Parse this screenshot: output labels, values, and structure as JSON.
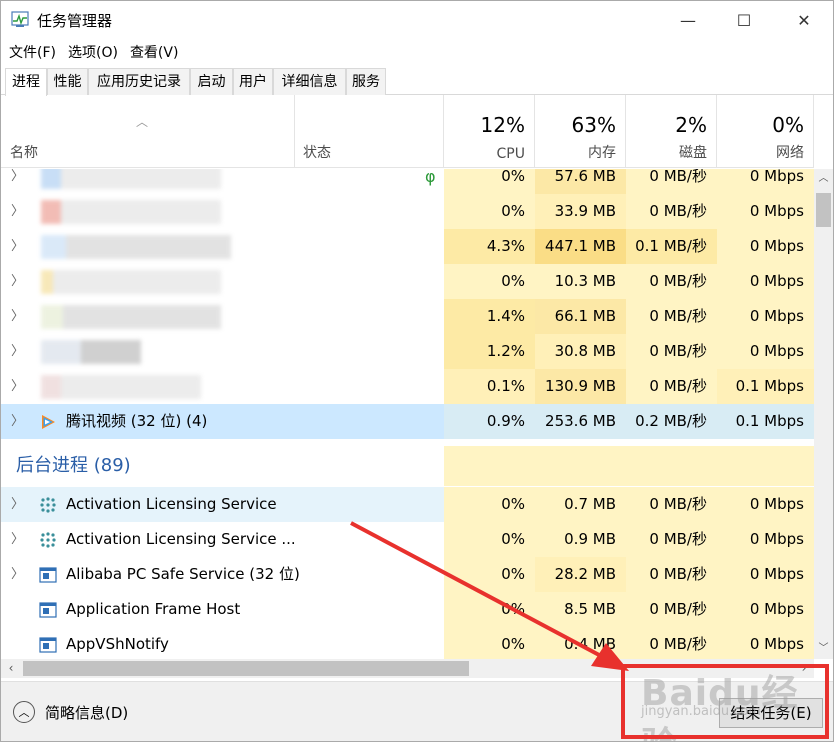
{
  "window": {
    "title": "任务管理器",
    "minimize": "—",
    "maximize": "☐",
    "close": "✕"
  },
  "menu": [
    "文件(F)",
    "选项(O)",
    "查看(V)"
  ],
  "tabs": [
    "进程",
    "性能",
    "应用历史记录",
    "启动",
    "用户",
    "详细信息",
    "服务"
  ],
  "columns": {
    "name": "名称",
    "status": "状态",
    "cpu": {
      "pct": "12%",
      "label": "CPU"
    },
    "mem": {
      "pct": "63%",
      "label": "内存"
    },
    "disk": {
      "pct": "2%",
      "label": "磁盘"
    },
    "net": {
      "pct": "0%",
      "label": "网络"
    }
  },
  "app_rows": [
    {
      "cpu": "0%",
      "mem": "57.6 MB",
      "disk": "0 MB/秒",
      "net": "0 Mbps"
    },
    {
      "cpu": "0%",
      "mem": "33.9 MB",
      "disk": "0 MB/秒",
      "net": "0 Mbps"
    },
    {
      "cpu": "4.3%",
      "mem": "447.1 MB",
      "disk": "0.1 MB/秒",
      "net": "0 Mbps"
    },
    {
      "cpu": "0%",
      "mem": "10.3 MB",
      "disk": "0 MB/秒",
      "net": "0 Mbps"
    },
    {
      "cpu": "1.4%",
      "mem": "66.1 MB",
      "disk": "0 MB/秒",
      "net": "0 Mbps"
    },
    {
      "cpu": "1.2%",
      "mem": "30.8 MB",
      "disk": "0 MB/秒",
      "net": "0 Mbps"
    },
    {
      "cpu": "0.1%",
      "mem": "130.9 MB",
      "disk": "0 MB/秒",
      "net": "0.1 Mbps"
    },
    {
      "name": "腾讯视频 (32 位) (4)",
      "cpu": "0.9%",
      "mem": "253.6 MB",
      "disk": "0.2 MB/秒",
      "net": "0.1 Mbps"
    }
  ],
  "background_group": "后台进程 (89)",
  "bg_rows": [
    {
      "name": "Activation Licensing Service",
      "cpu": "0%",
      "mem": "0.7 MB",
      "disk": "0 MB/秒",
      "net": "0 Mbps"
    },
    {
      "name": "Activation Licensing Service ...",
      "cpu": "0%",
      "mem": "0.9 MB",
      "disk": "0 MB/秒",
      "net": "0 Mbps"
    },
    {
      "name": "Alibaba PC Safe Service (32 位)",
      "cpu": "0%",
      "mem": "28.2 MB",
      "disk": "0 MB/秒",
      "net": "0 Mbps"
    },
    {
      "name": "Application Frame Host",
      "cpu": "0%",
      "mem": "8.5 MB",
      "disk": "0 MB/秒",
      "net": "0 Mbps"
    },
    {
      "name": "AppVShNotify",
      "cpu": "0%",
      "mem": "0.4 MB",
      "disk": "0 MB/秒",
      "net": "0 Mbps"
    }
  ],
  "footer": {
    "fewer": "简略信息(D)",
    "end_task": "结束任务(E)"
  },
  "watermark": {
    "main": "Baidu经验",
    "sub": "jingyan.baidu.com"
  },
  "colors": {
    "accent_group": "#2a5ea7",
    "selected_row": "#cce8ff",
    "annotation_red": "#e8312d"
  }
}
